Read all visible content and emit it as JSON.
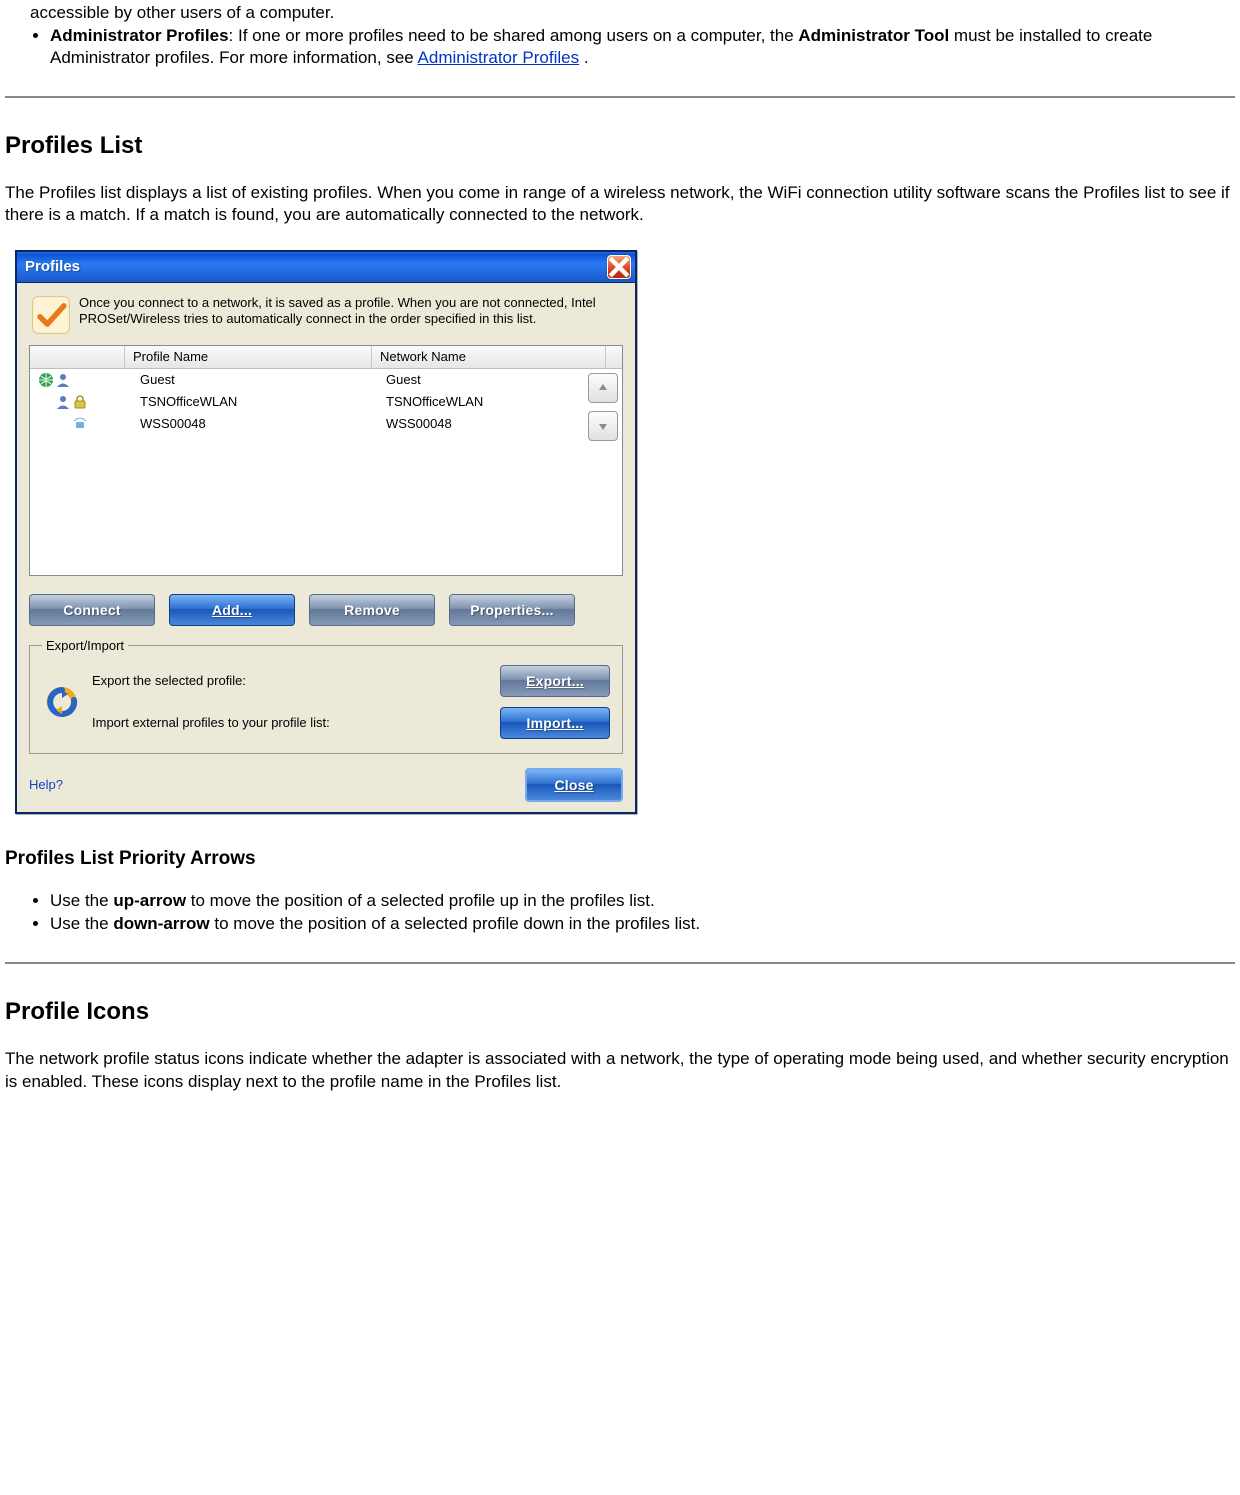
{
  "intro": {
    "user_other_text": "accessible by other users of a computer.",
    "admin_bold": "Administrator Profiles",
    "admin_text_1": ": If one or more profiles need to be shared among users on a computer, the ",
    "admin_bold_2": "Administrator Tool",
    "admin_text_2": " must be installed to create Administrator profiles. For more information, see ",
    "admin_link": "Administrator Profiles",
    "admin_text_3": " ."
  },
  "profiles_list": {
    "heading": "Profiles List",
    "desc": "The Profiles list displays a list of existing profiles. When you come in range of a wireless network, the WiFi connection utility software scans the Profiles list to see if there is a match. If a match is found, you are automatically connected to the network."
  },
  "dialog": {
    "title": "Profiles",
    "intro": "Once you connect to a network, it is saved as a profile. When you are not connected, Intel PROSet/Wireless tries to automatically connect in the order specified in this list.",
    "columns": {
      "profile": "Profile Name",
      "network": "Network Name"
    },
    "rows": [
      {
        "profile": "Guest",
        "network": "Guest"
      },
      {
        "profile": "TSNOfficeWLAN",
        "network": "TSNOfficeWLAN"
      },
      {
        "profile": "WSS00048",
        "network": "WSS00048"
      }
    ],
    "buttons": {
      "connect": "Connect",
      "add": "Add...",
      "remove": "Remove",
      "properties": "Properties..."
    },
    "export_import": {
      "legend": "Export/Import",
      "export_label": "Export the selected profile:",
      "import_label": "Import external profiles to your profile list:",
      "export_btn": "Export...",
      "import_btn": "Import..."
    },
    "help": "Help?",
    "close": "Close"
  },
  "priority": {
    "heading": "Profiles List Priority Arrows",
    "up_pre": "Use the ",
    "up_bold": "up-arrow",
    "up_post": " to move the position of a selected profile up in the profiles list.",
    "down_pre": "Use the ",
    "down_bold": "down-arrow",
    "down_post": " to move the position of a selected profile down in the profiles list."
  },
  "icons": {
    "heading": "Profile Icons",
    "desc": "The network profile status icons indicate whether the adapter is associated with a network, the type of operating mode being used, and whether security encryption is enabled. These icons display next to the profile name in the Profiles list."
  }
}
